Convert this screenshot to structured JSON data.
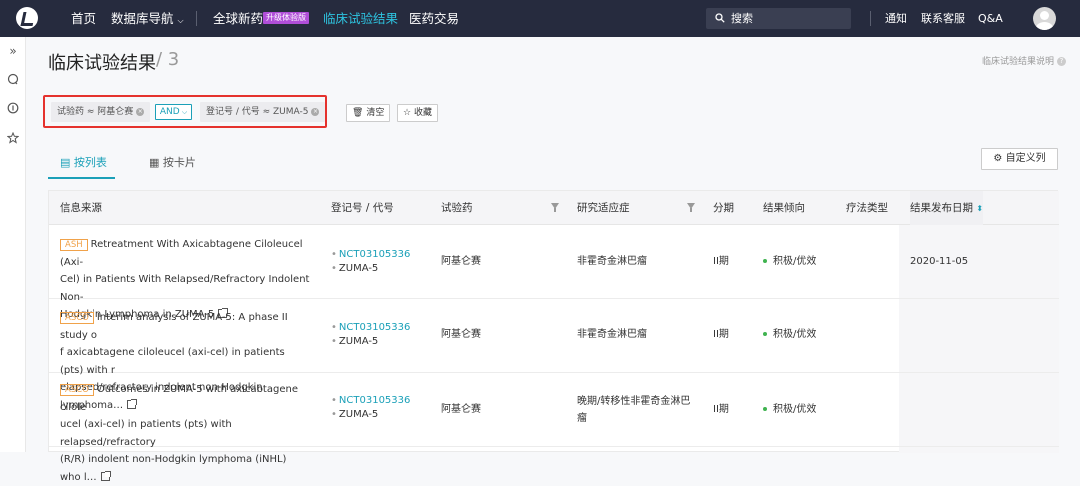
{
  "topbar": {
    "nav": [
      "首页",
      "数据库导航",
      "全球新药",
      "临床试验结果",
      "医药交易"
    ],
    "upgrade_badge": "升级体验版",
    "search_placeholder": "搜索",
    "right_links": [
      "通知",
      "联系客服",
      "Q&A"
    ]
  },
  "page": {
    "title": "临床试验结果",
    "count": "/ 3",
    "help_link": "临床试验结果说明"
  },
  "filters": {
    "chip1": "试验药 ≈ 阿基仑赛",
    "operator": "AND",
    "chip2": "登记号 / 代号 ≈ ZUMA-5",
    "clear_label": "清空",
    "favorite_label": "收藏"
  },
  "tabs": {
    "list": "按列表",
    "card": "按卡片",
    "custom_columns": "自定义列"
  },
  "columns": [
    "信息来源",
    "登记号 / 代号",
    "试验药",
    "研究适应症",
    "分期",
    "结果倾向",
    "疗法类型",
    "结果发布日期"
  ],
  "rows": [
    {
      "tag": "ASH",
      "line1": "Retreatment With Axicabtagene Ciloleucel (Axi-",
      "line2": "Cel) in Patients With Relapsed/Refractory Indolent Non-",
      "line3": "Hodgkin Lymphoma in ZUMA-5",
      "reg_id": "NCT03105336",
      "reg_code": "ZUMA-5",
      "drug": "阿基仑赛",
      "indication": "非霍奇金淋巴瘤",
      "phase": "II期",
      "tendency": "积极/优效",
      "date": "2020-11-05"
    },
    {
      "tag": "ASCO",
      "line1": "Interim analysis of ZUMA-5: A phase II study o",
      "line2": "f axicabtagene ciloleucel (axi-cel) in patients (pts) with r",
      "line3": "elapsed/refractory indolent non-Hodgkin lymphoma…",
      "reg_id": "NCT03105336",
      "reg_code": "ZUMA-5",
      "drug": "阿基仑赛",
      "indication": "非霍奇金淋巴瘤",
      "phase": "II期",
      "tendency": "积极/优效",
      "date": ""
    },
    {
      "tag": "ASCO",
      "line1": "Outcomes in ZUMA-5 with axicabtagene cilole",
      "line2": "ucel (axi-cel) in patients (pts) with relapsed/refractory",
      "line3": "(R/R) indolent non-Hodgkin lymphoma (iNHL) who l…",
      "reg_id": "NCT03105336",
      "reg_code": "ZUMA-5",
      "drug": "阿基仑赛",
      "indication_line1": "晚期/转移性非霍奇金淋巴",
      "indication_line2": "瘤",
      "phase": "II期",
      "tendency": "积极/优效",
      "date": ""
    }
  ]
}
